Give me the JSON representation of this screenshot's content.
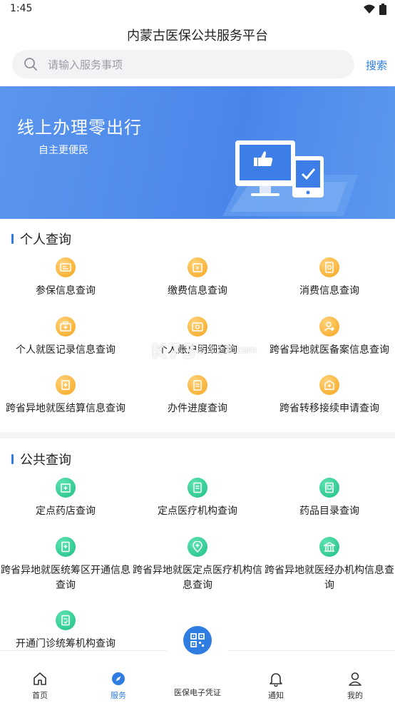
{
  "status_bar": {
    "time": "1:45"
  },
  "header": {
    "title": "内蒙古医保公共服务平台"
  },
  "search": {
    "placeholder": "请输入服务事项",
    "button": "搜索"
  },
  "banner": {
    "title": "线上办理零出行",
    "subtitle": "自主更便民"
  },
  "personal": {
    "title": "个人查询",
    "items": [
      {
        "label": "参保信息查询",
        "icon": "insurance-card-icon"
      },
      {
        "label": "缴费信息查询",
        "icon": "payment-icon"
      },
      {
        "label": "消费信息查询",
        "icon": "receipt-icon"
      },
      {
        "label": "个人就医记录信息查询",
        "icon": "medical-kit-icon"
      },
      {
        "label": "个人账户明细查询",
        "icon": "wallet-icon"
      },
      {
        "label": "跨省异地就医备案信息查询",
        "icon": "person-record-icon"
      },
      {
        "label": "跨省异地就医结算信息查询",
        "icon": "settlement-icon"
      },
      {
        "label": "办件进度查询",
        "icon": "progress-icon"
      },
      {
        "label": "跨省转移接续申请查询",
        "icon": "transfer-icon"
      }
    ]
  },
  "public": {
    "title": "公共查询",
    "items": [
      {
        "label": "定点药店查询",
        "icon": "pharmacy-icon"
      },
      {
        "label": "定点医疗机构查询",
        "icon": "hospital-document-icon"
      },
      {
        "label": "药品目录查询",
        "icon": "drug-catalog-icon"
      },
      {
        "label": "跨省异地就医统筹区开通信息查询",
        "icon": "region-document-icon"
      },
      {
        "label": "跨省异地就医定点医疗机构信息查询",
        "icon": "location-cross-icon"
      },
      {
        "label": "跨省异地就医经办机构信息查询",
        "icon": "bank-institution-icon"
      },
      {
        "label": "开通门诊统筹机构查询",
        "icon": "clinic-document-icon"
      }
    ]
  },
  "tabbar": {
    "home": "首页",
    "service": "服务",
    "voucher": "医保电子凭证",
    "notice": "通知",
    "mine": "我的"
  },
  "watermark": {
    "text": "K73",
    "sub": "游戏之家",
    "domain": ".com"
  },
  "colors": {
    "accent": "#2f7de1",
    "orange_icon": "#f6a61e",
    "green_icon": "#1fbf86",
    "banner": "#4a86ea"
  }
}
